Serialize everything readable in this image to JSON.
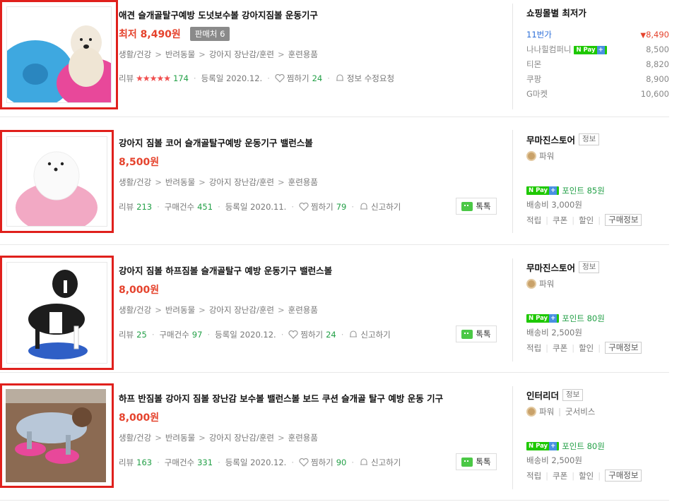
{
  "products": [
    {
      "title": "애견 슬개골탈구예방 도넛보수볼 강아지짐볼 운동기구",
      "price_prefix": "최저",
      "price": "8,490원",
      "sellers": "판매처 6",
      "categories": [
        "생활/건강",
        "반려동물",
        "강아지 장난감/훈련",
        "훈련용품"
      ],
      "review_label": "리뷰",
      "review_stars": "★★★★★",
      "review_count": "174",
      "date": "등록일 2020.12.",
      "wish_label": "찜하기",
      "wish_count": "24",
      "report_label": "정보 수정요청",
      "thumb_colors": [
        "#3ea8e0",
        "#e8489a",
        "#f1e9dc"
      ]
    },
    {
      "title": "강아지 짐볼 코어 슬개골탈구예방 운동기구 밸런스볼",
      "price": "8,500원",
      "categories": [
        "생활/건강",
        "반려동물",
        "강아지 장난감/훈련",
        "훈련용품"
      ],
      "review_label": "리뷰",
      "review_count": "213",
      "purchase_label": "구매건수",
      "purchase_count": "451",
      "date": "등록일 2020.11.",
      "wish_label": "찜하기",
      "wish_count": "79",
      "report_label": "신고하기",
      "talk_label": "톡톡",
      "store": {
        "name": "무마진스토어",
        "badge": "정보",
        "grade": "파워",
        "points": "포인트 85원",
        "shipping": "배송비 3,000원",
        "links": [
          "적립",
          "쿠폰",
          "할인"
        ],
        "info_link": "구매정보"
      }
    },
    {
      "title": "강아지 짐볼 하프짐볼 슬개골탈구 예방 운동기구 밸런스볼",
      "price": "8,000원",
      "categories": [
        "생활/건강",
        "반려동물",
        "강아지 장난감/훈련",
        "훈련용품"
      ],
      "review_label": "리뷰",
      "review_count": "25",
      "purchase_label": "구매건수",
      "purchase_count": "97",
      "date": "등록일 2020.12.",
      "wish_label": "찜하기",
      "wish_count": "24",
      "report_label": "신고하기",
      "talk_label": "톡톡",
      "store": {
        "name": "무마진스토어",
        "badge": "정보",
        "grade": "파워",
        "points": "포인트 80원",
        "shipping": "배송비 2,500원",
        "links": [
          "적립",
          "쿠폰",
          "할인"
        ],
        "info_link": "구매정보"
      }
    },
    {
      "title": "하프 반짐볼 강아지 짐볼 장난감 보수볼 밸런스볼 보드 쿠션 슬개골 탈구 예방 운동 기구",
      "price": "8,000원",
      "categories": [
        "생활/건강",
        "반려동물",
        "강아지 장난감/훈련",
        "훈련용품"
      ],
      "review_label": "리뷰",
      "review_count": "163",
      "purchase_label": "구매건수",
      "purchase_count": "331",
      "date": "등록일 2020.12.",
      "wish_label": "찜하기",
      "wish_count": "90",
      "report_label": "신고하기",
      "talk_label": "톡톡",
      "store": {
        "name": "인터리더",
        "badge": "정보",
        "grade": "파워",
        "extra": "굿서비스",
        "points": "포인트 80원",
        "shipping": "배송비 2,500원",
        "links": [
          "적립",
          "쿠폰",
          "할인"
        ],
        "info_link": "구매정보"
      }
    }
  ],
  "lowest_price_panel": {
    "title": "쇼핑몰별 최저가",
    "malls": [
      {
        "name": "11번가",
        "price": "8,490"
      },
      {
        "name": "나나힐컴퍼니",
        "price": "8,500"
      },
      {
        "name": "티몬",
        "price": "8,820"
      },
      {
        "name": "쿠팡",
        "price": "8,900"
      },
      {
        "name": "G마켓",
        "price": "10,600"
      }
    ]
  },
  "npay_label": "N Pay",
  "npay_plus": "+",
  "colors": {
    "accent_red": "#e5432d",
    "green": "#23a047",
    "highlight_box": "#e0201c",
    "link_blue": "#2b6ed8"
  }
}
